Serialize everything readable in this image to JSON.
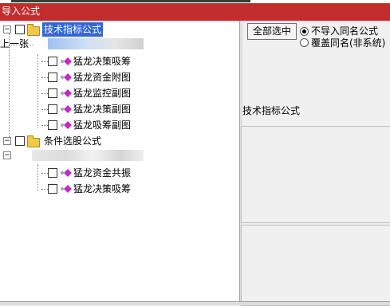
{
  "window": {
    "title": "导入公式"
  },
  "tree": {
    "groups": [
      {
        "label": "技术指标公式",
        "items": [
          "猛龙决策吸筹",
          "猛龙资金附图",
          "猛龙监控副图",
          "猛龙决策副图",
          "猛龙吸筹副图"
        ]
      },
      {
        "label": "条件选股公式",
        "items": [
          "猛龙资金共振",
          "猛龙决策吸筹"
        ]
      }
    ],
    "side_text": "上一张"
  },
  "right": {
    "select_all_button": "全部选中",
    "radio_options": [
      {
        "label": "不导入同名公式",
        "checked": true
      },
      {
        "label": "覆盖同名(非系统)",
        "checked": false
      }
    ],
    "section_label": "技术指标公式"
  },
  "colors": {
    "titlebar": "#c32c2c",
    "selection": "#3367d6"
  }
}
